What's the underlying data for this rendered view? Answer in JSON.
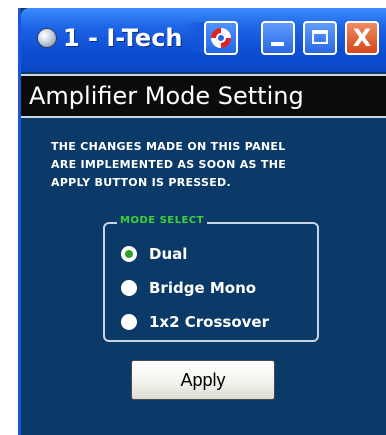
{
  "window": {
    "title": "1 - I-Tech",
    "icon": "app-orb-icon",
    "controls": {
      "help_icon": "help-lifebuoy-icon",
      "minimize_icon": "minimize-icon",
      "maximize_icon": "maximize-icon",
      "close_label": "X"
    }
  },
  "panel": {
    "title": "Amplifier Mode Setting",
    "notice": "THE CHANGES MADE ON THIS PANEL\nARE IMPLEMENTED AS SOON AS THE\nAPPLY BUTTON IS PRESSED."
  },
  "mode_select": {
    "legend": "MODE SELECT",
    "options": [
      {
        "label": "Dual",
        "selected": true
      },
      {
        "label": "Bridge Mono",
        "selected": false
      },
      {
        "label": "1x2 Crossover",
        "selected": false
      }
    ]
  },
  "apply_button": {
    "label": "Apply"
  },
  "colors": {
    "panel_bg": "#0b3a69",
    "title_bar": "#1e64e6",
    "legend_green": "#3fd13a",
    "close_red": "#d4471c"
  }
}
